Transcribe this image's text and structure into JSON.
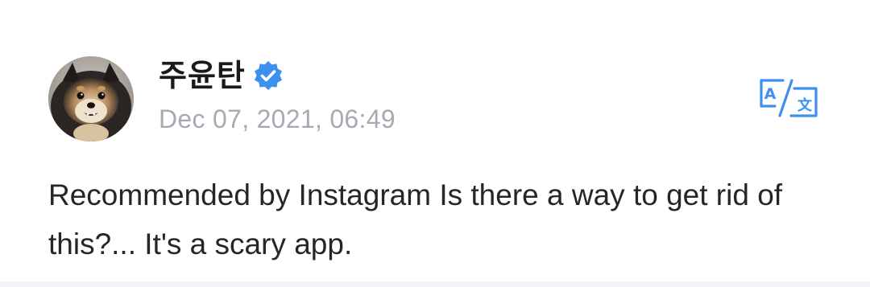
{
  "post": {
    "author": {
      "name": "주윤탄",
      "verified": true,
      "avatar_icon": "pomeranian-dog-avatar"
    },
    "timestamp": "Dec 07, 2021, 06:49",
    "translate_icon": "translate-icon",
    "body": "Recommended by Instagram Is there a way to get rid of this?... It's a scary app."
  },
  "colors": {
    "verified_badge": "#3d8ff0",
    "translate_icon": "#3d8ff0",
    "timestamp": "#a7a9b3",
    "body_text": "#262626",
    "background": "#ffffff"
  }
}
